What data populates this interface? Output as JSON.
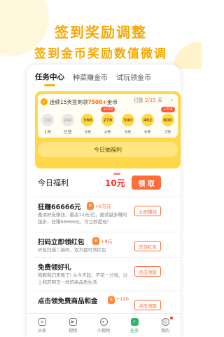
{
  "hero": {
    "title": "签到奖励调整",
    "subtitle": "签到金币奖励数值微调"
  },
  "tabs": [
    {
      "label": "任务中心",
      "active": true
    },
    {
      "label": "种菜赚金币",
      "active": false
    },
    {
      "label": "试玩领金币",
      "active": false
    }
  ],
  "signin": {
    "prefix": "连续15天签到领",
    "coins": "7500+",
    "suffix": "金币",
    "signed_label": "已签",
    "signed_ratio": "2/15",
    "signed_unit": "天",
    "days": [
      {
        "value": "102",
        "label": "1天",
        "done": true,
        "badge": ""
      },
      {
        "value": "240",
        "label": "已签",
        "done": true,
        "badge": ""
      },
      {
        "value": "366",
        "label": "3天",
        "done": false,
        "badge": ""
      },
      {
        "value": "270",
        "label": "4天",
        "done": false,
        "badge": "+120"
      },
      {
        "value": "300",
        "label": "5天",
        "done": false,
        "badge": ""
      },
      {
        "value": "402",
        "label": "6天",
        "done": false,
        "badge": ""
      },
      {
        "value": "600",
        "label": "7天",
        "done": false,
        "badge": "+216"
      }
    ],
    "lottery_label": "今日抽福利"
  },
  "welfare": {
    "title": "今日福利",
    "amount": "10元",
    "button": "领 取"
  },
  "tasks": [
    {
      "title": "狂赚66666元",
      "badge": "¥",
      "reward": "+6万元",
      "desc": "邀请好友赚钱，最高12元/位，邀请越多赚的越多，狂赚66666元，可立即提现!",
      "button": "立即赚钱"
    },
    {
      "title": "扫码立即领红包",
      "badge": "¥",
      "reward": "+8元",
      "desc": "好友扫描二维码，双方都可领红包",
      "button": "去领红包"
    },
    {
      "title": "免费领好礼",
      "badge": "",
      "reward": "",
      "desc": "抱歉我们来晚了! 从今天起，不花一分钱，过上和苏明玉一样的高品质生活",
      "button": "点击领取"
    },
    {
      "title": "点击领免费商品和金",
      "badge": "¥",
      "reward": "+120",
      "desc": "",
      "button": "点击领取"
    }
  ],
  "nav": [
    {
      "label": "头条",
      "icon": "news-icon",
      "active": false,
      "dot": false
    },
    {
      "label": "视频",
      "icon": "video-icon",
      "active": false,
      "dot": false
    },
    {
      "label": "小视频",
      "icon": "short-video-icon",
      "active": false,
      "dot": false
    },
    {
      "label": "任务",
      "icon": "task-icon",
      "active": true,
      "dot": false
    },
    {
      "label": "我的",
      "icon": "profile-icon",
      "active": false,
      "dot": true
    }
  ],
  "colors": {
    "accent": "#f6a900",
    "card": "#ffd84a",
    "cta": "#ff6d3a",
    "active_nav": "#33b36b"
  }
}
